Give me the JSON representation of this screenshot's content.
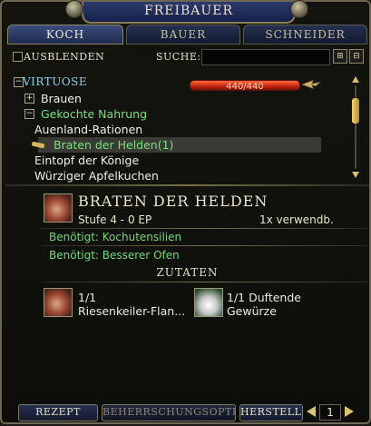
{
  "window": {
    "title": "FREIBAUER"
  },
  "tabs": [
    {
      "label": "KOCH",
      "active": true
    },
    {
      "label": "BAUER",
      "active": false
    },
    {
      "label": "SCHNEIDER",
      "active": false
    }
  ],
  "filter": {
    "hide_label": "AUSBLENDEN",
    "search_label": "SUCHE:",
    "search_value": ""
  },
  "tier": {
    "name": "VIRTUOSE",
    "xp_text": "440/440",
    "xp_fraction": 1.0
  },
  "recipe_list": [
    {
      "label": "Brauen",
      "toggle": "+",
      "color": "white"
    },
    {
      "label": "Gekochte Nahrung",
      "toggle": "-",
      "color": "green"
    },
    {
      "label": "Auenland-Rationen",
      "color": "white"
    },
    {
      "label": "Braten der Helden(1)",
      "color": "green",
      "selected": true
    },
    {
      "label": "Eintopf der Könige",
      "color": "white"
    },
    {
      "label": "Würziger Apfelkuchen",
      "color": "white"
    }
  ],
  "detail": {
    "title": "BRATEN DER HELDEN",
    "level": "Stufe 4 - 0 EP",
    "uses": "1x verwendb.",
    "requirements": [
      "Benötigt: Kochutensilien",
      "Benötigt: Besserer Ofen"
    ],
    "ingredients_header": "ZUTATEN",
    "ingredients": [
      {
        "count": "1/1",
        "name": "Riesenkeiler-Flan...",
        "icon": "meat-icon"
      },
      {
        "count": "1/1 Duftende",
        "name": "Gewürze",
        "icon": "spice-bag-icon"
      }
    ]
  },
  "footer": {
    "recipe_tab": "REZEPT",
    "mastery_tab": "BEHERRSCHUNGSOPTIO...",
    "craft_button": "HERSTELL...",
    "page": "1"
  }
}
